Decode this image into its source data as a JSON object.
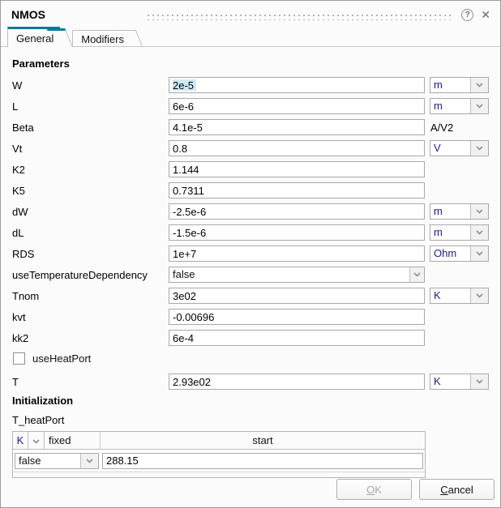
{
  "dialog": {
    "title": "NMOS"
  },
  "titlebar": {
    "help_glyph": "?",
    "close_glyph": "✕"
  },
  "tabs": [
    {
      "label": "General",
      "active": true
    },
    {
      "label": "Modifiers",
      "active": false
    }
  ],
  "sections": {
    "parameters": "Parameters",
    "initialization": "Initialization"
  },
  "parameters": [
    {
      "name": "W",
      "value": "2e-5",
      "unit": "m",
      "widget": "combo",
      "selected": true
    },
    {
      "name": "L",
      "value": "6e-6",
      "unit": "m",
      "widget": "combo"
    },
    {
      "name": "Beta",
      "value": "4.1e-5",
      "unit": "A/V2",
      "widget": "text"
    },
    {
      "name": "Vt",
      "value": "0.8",
      "unit": "V",
      "widget": "combo"
    },
    {
      "name": "K2",
      "value": "1.144",
      "unit": "",
      "widget": "plain"
    },
    {
      "name": "K5",
      "value": "0.7311",
      "unit": "",
      "widget": "plain"
    },
    {
      "name": "dW",
      "value": "-2.5e-6",
      "unit": "m",
      "widget": "combo"
    },
    {
      "name": "dL",
      "value": "-1.5e-6",
      "unit": "m",
      "widget": "combo"
    },
    {
      "name": "RDS",
      "value": "1e+7",
      "unit": "Ohm",
      "widget": "combo"
    },
    {
      "name": "useTemperatureDependency",
      "value": "false",
      "unit": "",
      "widget": "dropdown"
    },
    {
      "name": "Tnom",
      "value": "3e02",
      "unit": "K",
      "widget": "combo"
    },
    {
      "name": "kvt",
      "value": "-0.00696",
      "unit": "",
      "widget": "plain"
    },
    {
      "name": "kk2",
      "value": "6e-4",
      "unit": "",
      "widget": "plain"
    }
  ],
  "heatport_checkbox": {
    "label": "useHeatPort",
    "checked": false
  },
  "t_row": {
    "name": "T",
    "value": "2.93e02",
    "unit": "K",
    "widget": "combo"
  },
  "init": {
    "variable": "T_heatPort",
    "table": {
      "unit": "K",
      "fixed_header": "fixed",
      "start_header": "start",
      "row": {
        "fixed": "false",
        "start": "288.15"
      }
    }
  },
  "buttons": {
    "ok": "OK",
    "cancel": "Cancel"
  },
  "colors": {
    "accent": "#0b7a9b",
    "selection": "#cfe9f7"
  }
}
